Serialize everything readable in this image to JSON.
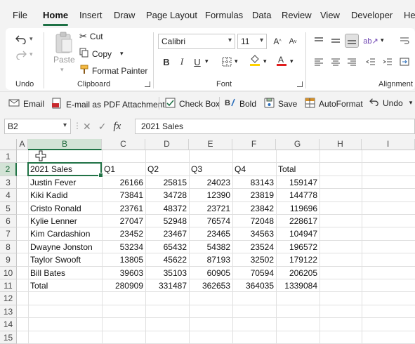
{
  "menu": {
    "items": [
      "File",
      "Home",
      "Insert",
      "Draw",
      "Page Layout",
      "Formulas",
      "Data",
      "Review",
      "View",
      "Developer",
      "Help"
    ],
    "active": "Home"
  },
  "ribbon": {
    "undo_group": {
      "label": "Undo"
    },
    "clipboard": {
      "label": "Clipboard",
      "paste": "Paste",
      "cut": "Cut",
      "copy": "Copy",
      "format_painter": "Format Painter"
    },
    "font": {
      "label": "Font",
      "name": "Calibri",
      "size": "11",
      "bold": "B",
      "italic": "I",
      "underline": "U",
      "font_color": "#e01e1e",
      "fill_color": "#ffd200"
    },
    "alignment": {
      "label": "Alignment"
    }
  },
  "quick_toolbar": {
    "email": "Email",
    "email_pdf": "E-mail as PDF Attachment",
    "check_box": "Check Box",
    "bold": "Bold",
    "save": "Save",
    "autoformat": "AutoFormat",
    "undo": "Undo"
  },
  "formula_bar": {
    "name_box": "B2",
    "fx": "fx",
    "content": "2021 Sales"
  },
  "sheet": {
    "columns": [
      "A",
      "B",
      "C",
      "D",
      "E",
      "F",
      "G",
      "H",
      "I"
    ],
    "rows": [
      "1",
      "2",
      "3",
      "4",
      "5",
      "6",
      "7",
      "8",
      "9",
      "10",
      "11",
      "12",
      "13",
      "14",
      "15"
    ],
    "header_row": [
      "2021 Sales",
      "Q1",
      "Q2",
      "Q3",
      "Q4",
      "Total"
    ],
    "data": [
      {
        "name": "Justin Fever",
        "q1": "26166",
        "q2": "25815",
        "q3": "24023",
        "q4": "83143",
        "total": "159147"
      },
      {
        "name": "Kiki Kadid",
        "q1": "73841",
        "q2": "34728",
        "q3": "12390",
        "q4": "23819",
        "total": "144778"
      },
      {
        "name": "Cristo Ronald",
        "q1": "23761",
        "q2": "48372",
        "q3": "23721",
        "q4": "23842",
        "total": "119696"
      },
      {
        "name": "Kylie Lenner",
        "q1": "27047",
        "q2": "52948",
        "q3": "76574",
        "q4": "72048",
        "total": "228617"
      },
      {
        "name": "Kim Cardashion",
        "q1": "23452",
        "q2": "23467",
        "q3": "23465",
        "q4": "34563",
        "total": "104947"
      },
      {
        "name": "Dwayne Jonston",
        "q1": "53234",
        "q2": "65432",
        "q3": "54382",
        "q4": "23524",
        "total": "196572"
      },
      {
        "name": "Taylor Swooft",
        "q1": "13805",
        "q2": "45622",
        "q3": "87193",
        "q4": "32502",
        "total": "179122"
      },
      {
        "name": "Bill Bates",
        "q1": "39603",
        "q2": "35103",
        "q3": "60905",
        "q4": "70594",
        "total": "206205"
      },
      {
        "name": "Total",
        "q1": "280909",
        "q2": "331487",
        "q3": "362653",
        "q4": "364035",
        "total": "1339084"
      }
    ],
    "selected_cell": "B2",
    "accent": "#217346"
  }
}
